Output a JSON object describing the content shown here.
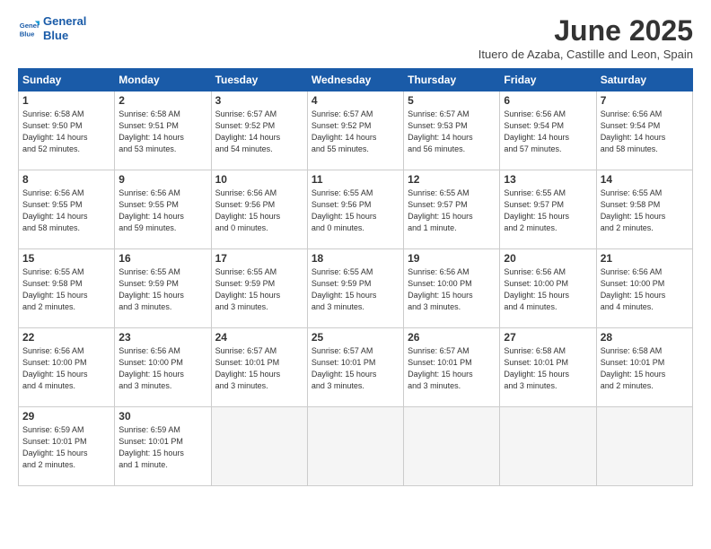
{
  "logo": {
    "line1": "General",
    "line2": "Blue"
  },
  "title": "June 2025",
  "subtitle": "Ituero de Azaba, Castille and Leon, Spain",
  "headers": [
    "Sunday",
    "Monday",
    "Tuesday",
    "Wednesday",
    "Thursday",
    "Friday",
    "Saturday"
  ],
  "weeks": [
    [
      {
        "day": "1",
        "lines": [
          "Sunrise: 6:58 AM",
          "Sunset: 9:50 PM",
          "Daylight: 14 hours",
          "and 52 minutes."
        ]
      },
      {
        "day": "2",
        "lines": [
          "Sunrise: 6:58 AM",
          "Sunset: 9:51 PM",
          "Daylight: 14 hours",
          "and 53 minutes."
        ]
      },
      {
        "day": "3",
        "lines": [
          "Sunrise: 6:57 AM",
          "Sunset: 9:52 PM",
          "Daylight: 14 hours",
          "and 54 minutes."
        ]
      },
      {
        "day": "4",
        "lines": [
          "Sunrise: 6:57 AM",
          "Sunset: 9:52 PM",
          "Daylight: 14 hours",
          "and 55 minutes."
        ]
      },
      {
        "day": "5",
        "lines": [
          "Sunrise: 6:57 AM",
          "Sunset: 9:53 PM",
          "Daylight: 14 hours",
          "and 56 minutes."
        ]
      },
      {
        "day": "6",
        "lines": [
          "Sunrise: 6:56 AM",
          "Sunset: 9:54 PM",
          "Daylight: 14 hours",
          "and 57 minutes."
        ]
      },
      {
        "day": "7",
        "lines": [
          "Sunrise: 6:56 AM",
          "Sunset: 9:54 PM",
          "Daylight: 14 hours",
          "and 58 minutes."
        ]
      }
    ],
    [
      {
        "day": "8",
        "lines": [
          "Sunrise: 6:56 AM",
          "Sunset: 9:55 PM",
          "Daylight: 14 hours",
          "and 58 minutes."
        ]
      },
      {
        "day": "9",
        "lines": [
          "Sunrise: 6:56 AM",
          "Sunset: 9:55 PM",
          "Daylight: 14 hours",
          "and 59 minutes."
        ]
      },
      {
        "day": "10",
        "lines": [
          "Sunrise: 6:56 AM",
          "Sunset: 9:56 PM",
          "Daylight: 15 hours",
          "and 0 minutes."
        ]
      },
      {
        "day": "11",
        "lines": [
          "Sunrise: 6:55 AM",
          "Sunset: 9:56 PM",
          "Daylight: 15 hours",
          "and 0 minutes."
        ]
      },
      {
        "day": "12",
        "lines": [
          "Sunrise: 6:55 AM",
          "Sunset: 9:57 PM",
          "Daylight: 15 hours",
          "and 1 minute."
        ]
      },
      {
        "day": "13",
        "lines": [
          "Sunrise: 6:55 AM",
          "Sunset: 9:57 PM",
          "Daylight: 15 hours",
          "and 2 minutes."
        ]
      },
      {
        "day": "14",
        "lines": [
          "Sunrise: 6:55 AM",
          "Sunset: 9:58 PM",
          "Daylight: 15 hours",
          "and 2 minutes."
        ]
      }
    ],
    [
      {
        "day": "15",
        "lines": [
          "Sunrise: 6:55 AM",
          "Sunset: 9:58 PM",
          "Daylight: 15 hours",
          "and 2 minutes."
        ]
      },
      {
        "day": "16",
        "lines": [
          "Sunrise: 6:55 AM",
          "Sunset: 9:59 PM",
          "Daylight: 15 hours",
          "and 3 minutes."
        ]
      },
      {
        "day": "17",
        "lines": [
          "Sunrise: 6:55 AM",
          "Sunset: 9:59 PM",
          "Daylight: 15 hours",
          "and 3 minutes."
        ]
      },
      {
        "day": "18",
        "lines": [
          "Sunrise: 6:55 AM",
          "Sunset: 9:59 PM",
          "Daylight: 15 hours",
          "and 3 minutes."
        ]
      },
      {
        "day": "19",
        "lines": [
          "Sunrise: 6:56 AM",
          "Sunset: 10:00 PM",
          "Daylight: 15 hours",
          "and 3 minutes."
        ]
      },
      {
        "day": "20",
        "lines": [
          "Sunrise: 6:56 AM",
          "Sunset: 10:00 PM",
          "Daylight: 15 hours",
          "and 4 minutes."
        ]
      },
      {
        "day": "21",
        "lines": [
          "Sunrise: 6:56 AM",
          "Sunset: 10:00 PM",
          "Daylight: 15 hours",
          "and 4 minutes."
        ]
      }
    ],
    [
      {
        "day": "22",
        "lines": [
          "Sunrise: 6:56 AM",
          "Sunset: 10:00 PM",
          "Daylight: 15 hours",
          "and 4 minutes."
        ]
      },
      {
        "day": "23",
        "lines": [
          "Sunrise: 6:56 AM",
          "Sunset: 10:00 PM",
          "Daylight: 15 hours",
          "and 3 minutes."
        ]
      },
      {
        "day": "24",
        "lines": [
          "Sunrise: 6:57 AM",
          "Sunset: 10:01 PM",
          "Daylight: 15 hours",
          "and 3 minutes."
        ]
      },
      {
        "day": "25",
        "lines": [
          "Sunrise: 6:57 AM",
          "Sunset: 10:01 PM",
          "Daylight: 15 hours",
          "and 3 minutes."
        ]
      },
      {
        "day": "26",
        "lines": [
          "Sunrise: 6:57 AM",
          "Sunset: 10:01 PM",
          "Daylight: 15 hours",
          "and 3 minutes."
        ]
      },
      {
        "day": "27",
        "lines": [
          "Sunrise: 6:58 AM",
          "Sunset: 10:01 PM",
          "Daylight: 15 hours",
          "and 3 minutes."
        ]
      },
      {
        "day": "28",
        "lines": [
          "Sunrise: 6:58 AM",
          "Sunset: 10:01 PM",
          "Daylight: 15 hours",
          "and 2 minutes."
        ]
      }
    ],
    [
      {
        "day": "29",
        "lines": [
          "Sunrise: 6:59 AM",
          "Sunset: 10:01 PM",
          "Daylight: 15 hours",
          "and 2 minutes."
        ]
      },
      {
        "day": "30",
        "lines": [
          "Sunrise: 6:59 AM",
          "Sunset: 10:01 PM",
          "Daylight: 15 hours",
          "and 1 minute."
        ]
      },
      {
        "day": "",
        "lines": []
      },
      {
        "day": "",
        "lines": []
      },
      {
        "day": "",
        "lines": []
      },
      {
        "day": "",
        "lines": []
      },
      {
        "day": "",
        "lines": []
      }
    ]
  ]
}
